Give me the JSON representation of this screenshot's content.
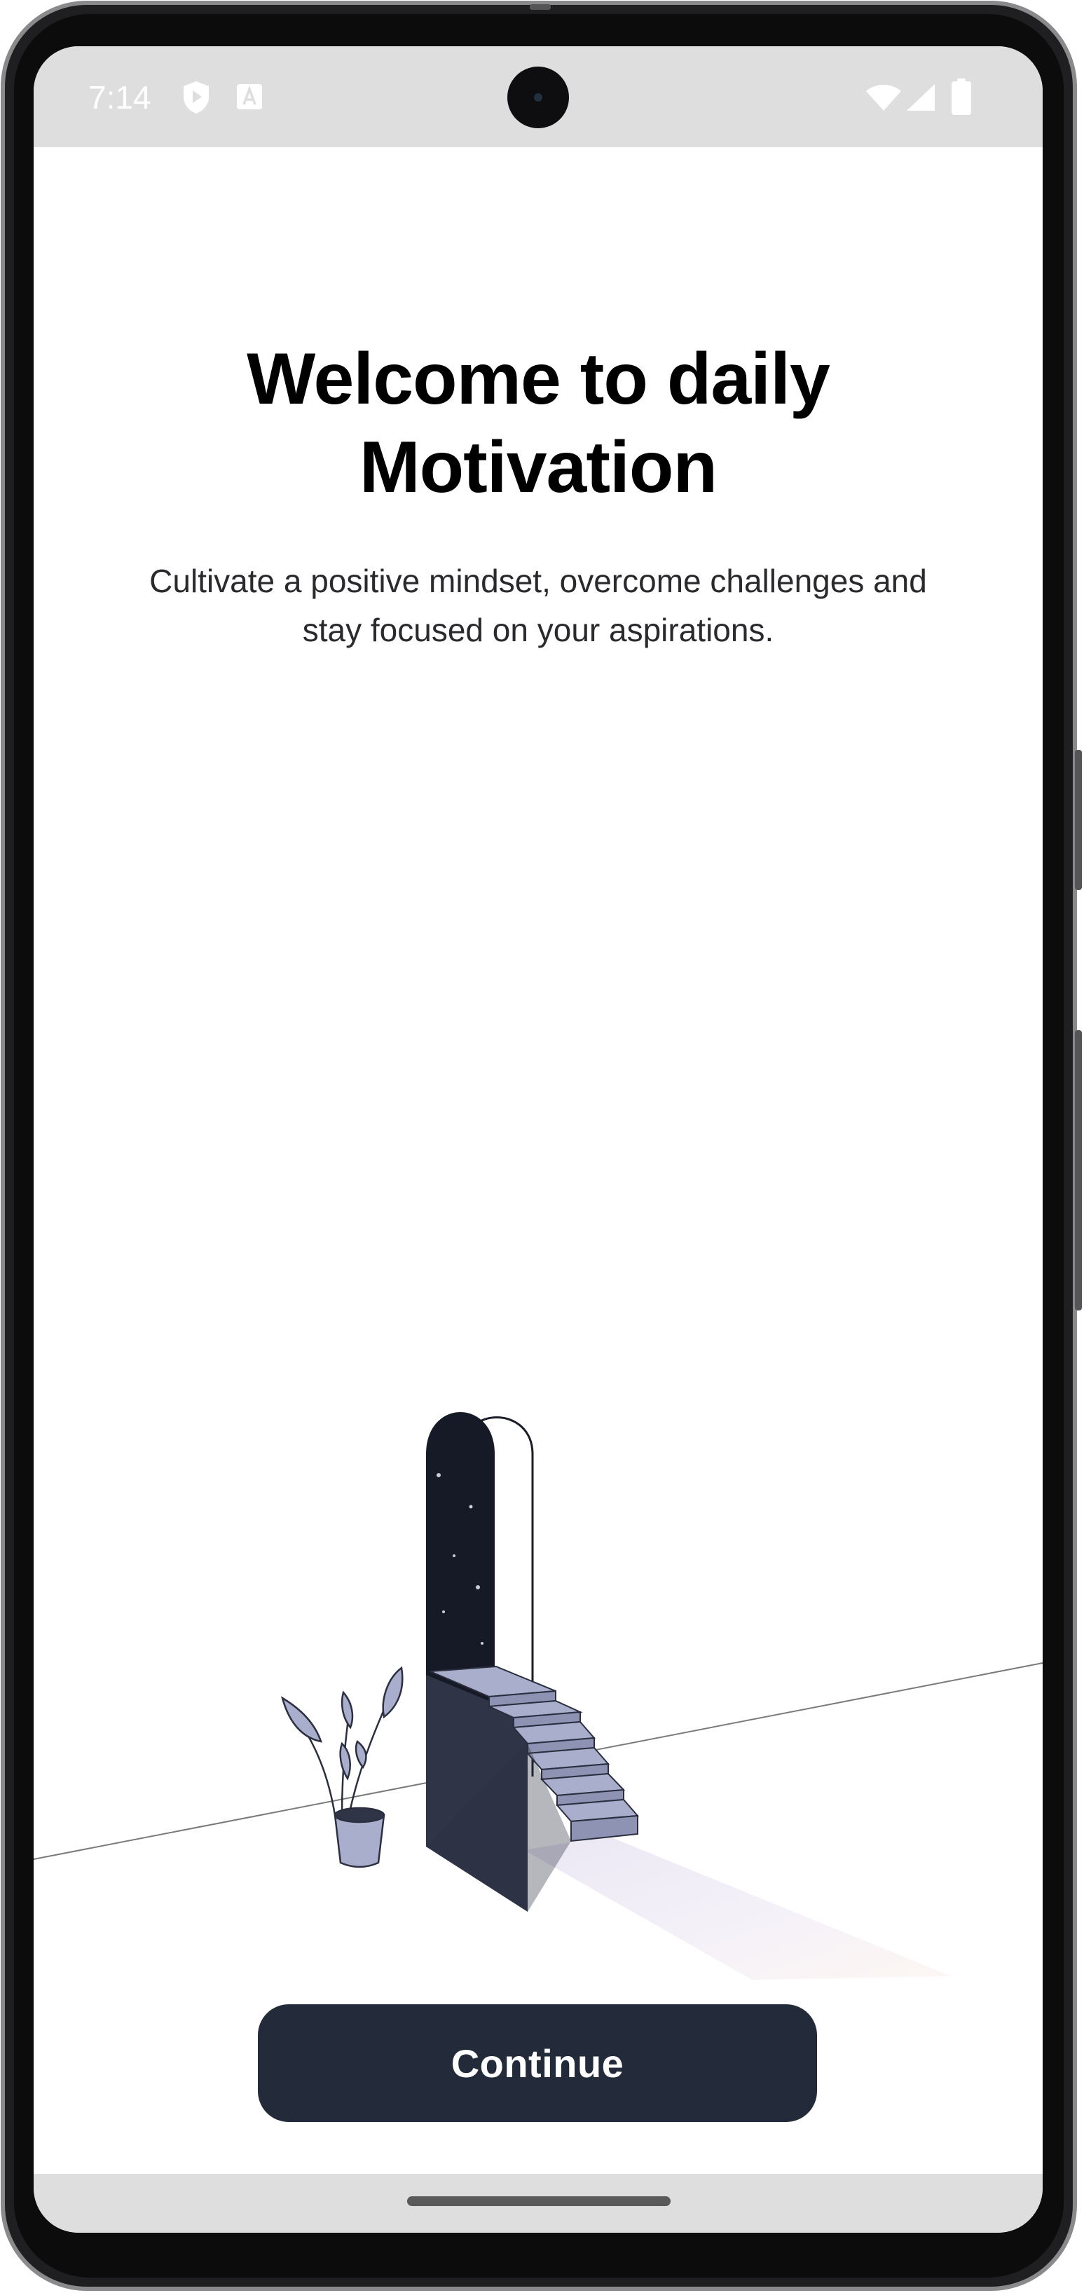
{
  "status_bar": {
    "time": "7:14",
    "left_icons": [
      "shield-play-icon",
      "font-a-icon"
    ],
    "right_icons": [
      "wifi-icon",
      "cellular-signal-icon",
      "battery-icon"
    ]
  },
  "onboarding": {
    "title": "Welcome to daily Motivation",
    "subtitle": "Cultivate a positive mindset, overcome challenges and stay focused on your aspirations.",
    "illustration": "doorway-stairs-plant-illustration",
    "continue_label": "Continue"
  },
  "colors": {
    "button_background": "#232B3A",
    "button_text": "#FFFFFF",
    "title_text": "#000000",
    "subtitle_text": "#2A2A2E",
    "stairs_fill": "#A9AECC",
    "doorway_fill": "#161A26",
    "system_bar": "#DEDEDE"
  }
}
